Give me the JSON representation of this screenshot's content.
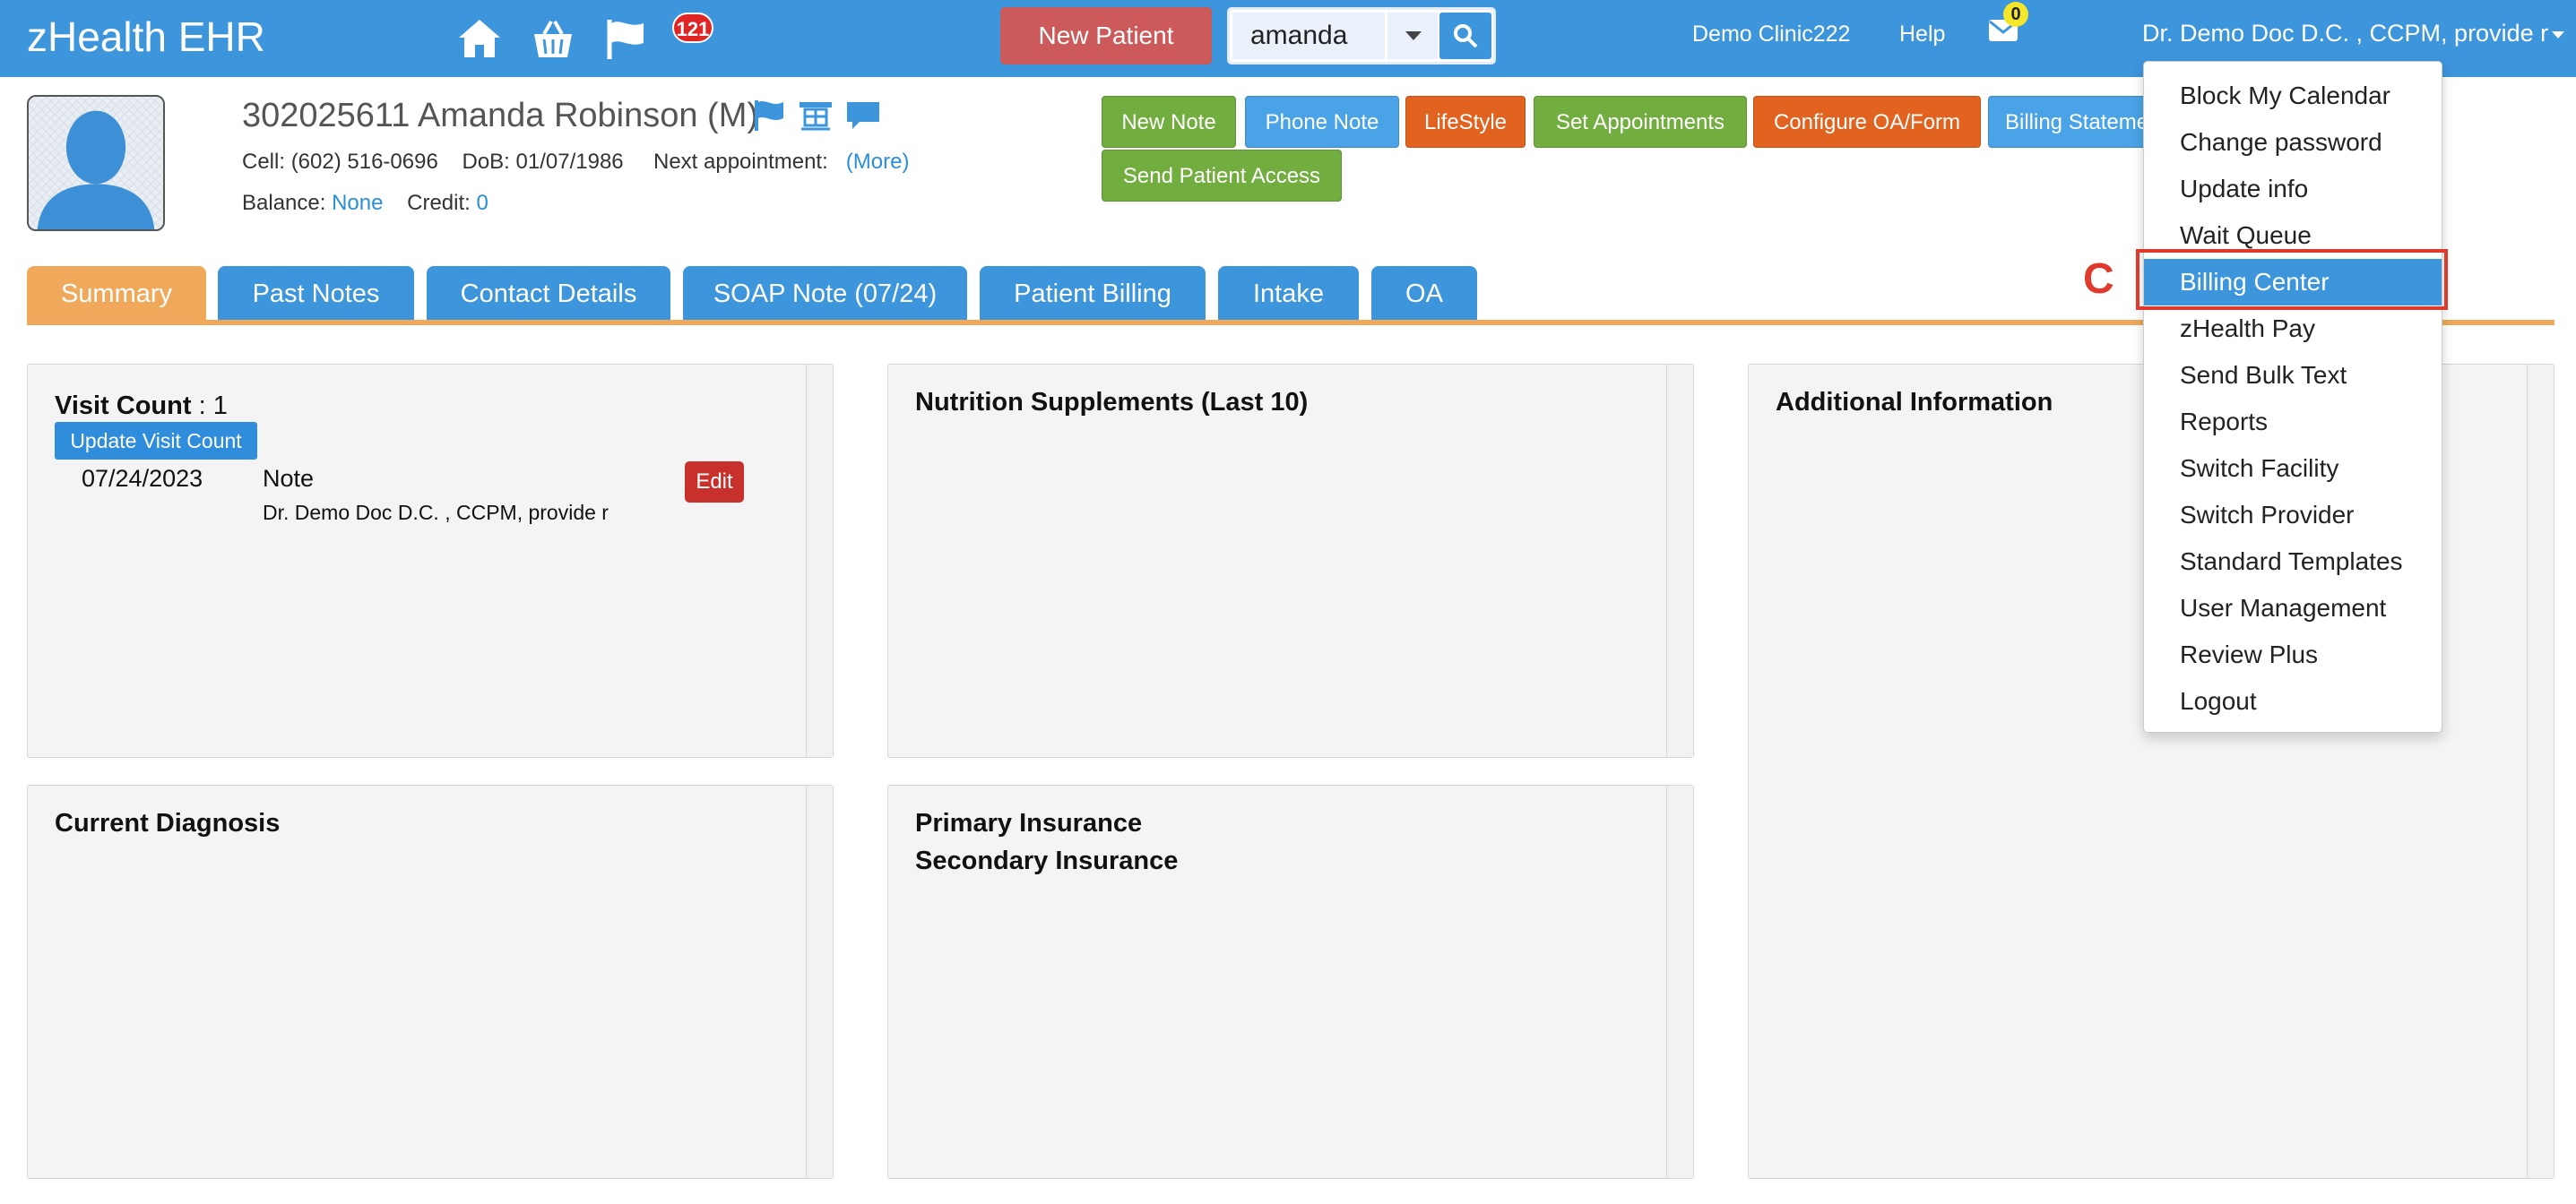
{
  "navbar": {
    "brand": "zHealth EHR",
    "notification_count": "121",
    "new_patient_label": "New Patient",
    "search_value": "amanda",
    "clinic": "Demo Clinic222",
    "help": "Help",
    "mail_count": "0",
    "user": "Dr. Demo Doc D.C. , CCPM, provide r",
    "icons": [
      "home-icon",
      "basket-icon",
      "flag-icon",
      "mail-icon",
      "search-icon",
      "caret-down-icon"
    ]
  },
  "patient": {
    "name_line": "302025611 Amanda Robinson (M)",
    "cell_label": "Cell:",
    "cell": "(602) 516-0696",
    "dob_label": "DoB:",
    "dob": "01/07/1986",
    "next_appointment_label": "Next appointment:",
    "more_link": "(More)",
    "balance_label": "Balance:",
    "balance": "None",
    "credit_label": "Credit:",
    "credit": "0"
  },
  "actions": [
    {
      "label": "New Note",
      "color": "#72ad3f"
    },
    {
      "label": "Phone Note",
      "color": "#4aa3e6"
    },
    {
      "label": "LifeStyle",
      "color": "#e2621f"
    },
    {
      "label": "Set Appointments",
      "color": "#72ad3f"
    },
    {
      "label": "Configure OA/Form",
      "color": "#e2621f"
    },
    {
      "label": "Billing Stateme",
      "color": "#4aa3e6"
    },
    {
      "label": "Send Patient Access",
      "color": "#72ad3f"
    }
  ],
  "tabs": [
    {
      "label": "Summary",
      "active": true
    },
    {
      "label": "Past Notes"
    },
    {
      "label": "Contact Details"
    },
    {
      "label": "SOAP Note (07/24)"
    },
    {
      "label": "Patient Billing"
    },
    {
      "label": "Intake"
    },
    {
      "label": "OA"
    }
  ],
  "panels": {
    "visit": {
      "label": "Visit Count",
      "value": " : 1",
      "update_button": "Update Visit Count",
      "entries": [
        {
          "date": "07/24/2023",
          "type": "Note",
          "provider": "Dr. Demo Doc D.C. , CCPM, provide r",
          "edit_label": "Edit"
        }
      ]
    },
    "nutrition_title": "Nutrition Supplements (Last 10)",
    "additional_title": "Additional Information",
    "diagnosis_title": "Current Diagnosis",
    "primary_insurance": "Primary Insurance",
    "secondary_insurance": "Secondary Insurance"
  },
  "dropdown": {
    "items": [
      "Block My Calendar",
      "Change password",
      "Update info",
      "Wait Queue",
      "Billing Center",
      "zHealth Pay",
      "Send Bulk Text",
      "Reports",
      "Switch Facility",
      "Switch Provider",
      "Standard Templates",
      "User Management",
      "Review Plus",
      "Logout"
    ],
    "selected": "Billing Center"
  },
  "annotation": {
    "marker": "C",
    "highlight_color": "#e03a2c"
  },
  "colors": {
    "primary": "#3d95dc",
    "active_tab": "#f0a95a",
    "danger": "#c8302c"
  }
}
